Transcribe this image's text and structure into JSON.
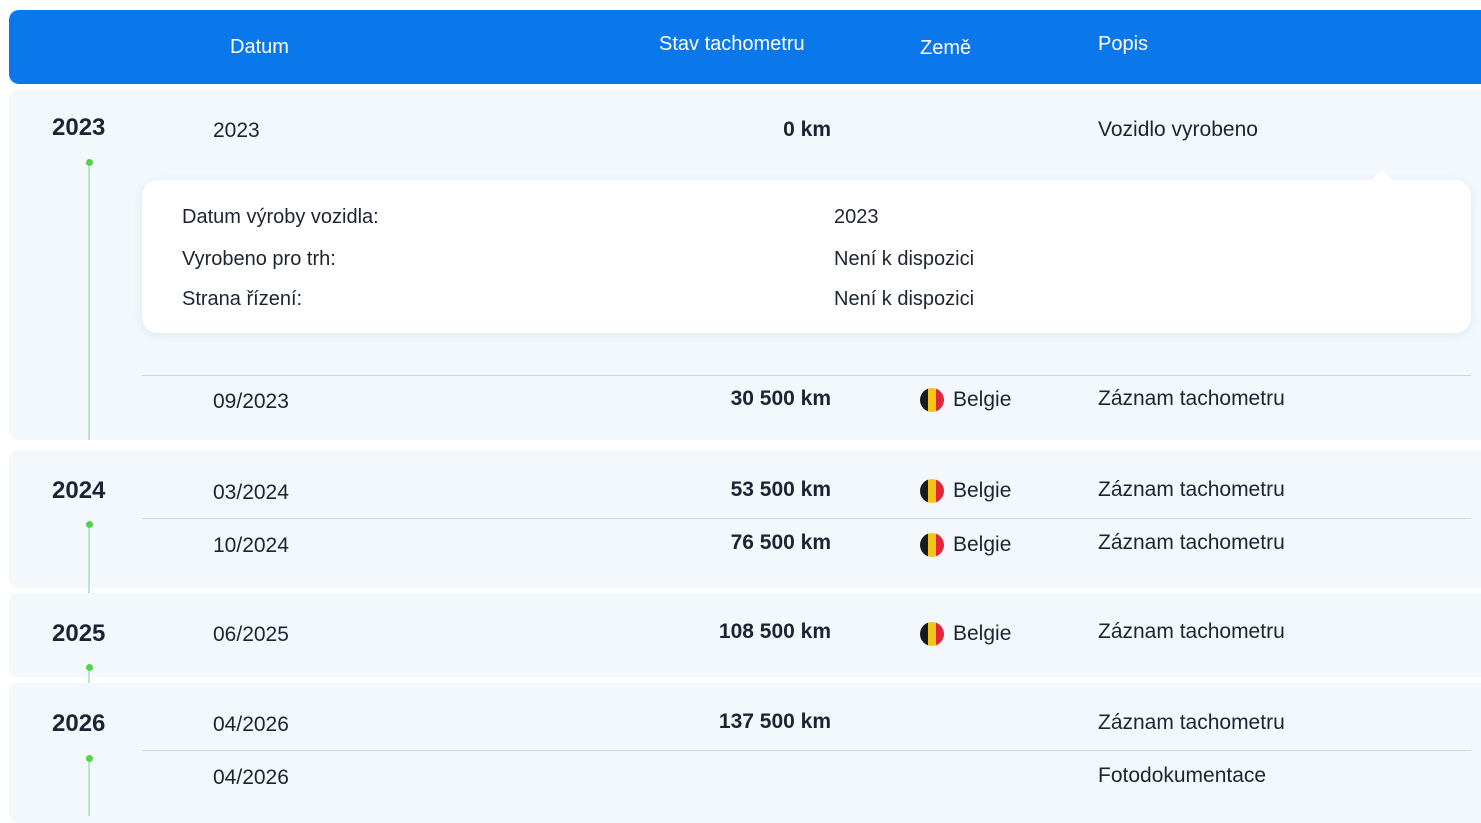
{
  "header": {
    "col_date": "Datum",
    "col_odometer": "Stav tachometru",
    "col_country": "Země",
    "col_description": "Popis",
    "color": "#0a77ea"
  },
  "years": [
    {
      "year": "2023",
      "rows": [
        {
          "date": "2023",
          "km": "0 km",
          "country": "",
          "description": "Vozidlo vyrobeno"
        },
        {
          "date": "09/2023",
          "km": "30 500 km",
          "country": "Belgie",
          "description": "Záznam tachometru"
        }
      ]
    },
    {
      "year": "2024",
      "rows": [
        {
          "date": "03/2024",
          "km": "53 500 km",
          "country": "Belgie",
          "description": "Záznam tachometru"
        },
        {
          "date": "10/2024",
          "km": "76 500 km",
          "country": "Belgie",
          "description": "Záznam tachometru"
        }
      ]
    },
    {
      "year": "2025",
      "rows": [
        {
          "date": "06/2025",
          "km": "108 500 km",
          "country": "Belgie",
          "description": "Záznam tachometru"
        }
      ]
    },
    {
      "year": "2026",
      "rows": [
        {
          "date": "04/2026",
          "km": "137 500 km",
          "country": "",
          "description": "Záznam tachometru"
        },
        {
          "date": "04/2026",
          "km": "",
          "country": "",
          "description": "Fotodokumentace"
        }
      ]
    }
  ],
  "details": [
    {
      "label": "Datum výroby vozidla:",
      "value": "2023"
    },
    {
      "label": "Vyrobeno pro trh:",
      "value": "Není k dispozici"
    },
    {
      "label": "Strana řízení:",
      "value": "Není k dispozici"
    }
  ],
  "flag_icon": "belgium-flag-icon",
  "colors": {
    "timeline_dot": "#56d14f",
    "group_bg": "#f2f8fc",
    "belgium": [
      "#1a1a1a",
      "#f5c518",
      "#e0283a"
    ]
  }
}
